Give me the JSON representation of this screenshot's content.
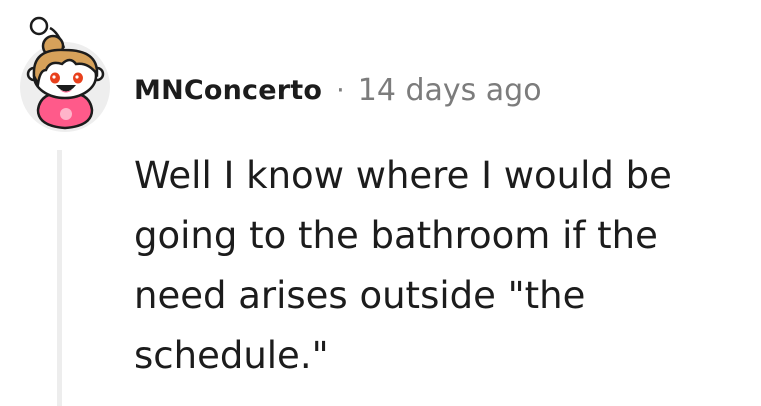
{
  "comment": {
    "author": "MNConcerto",
    "separator": "·",
    "timestamp": "14 days ago",
    "body": "Well I know where I would be going to the bathroom if the need arises outside \"the schedule.\"",
    "avatar": {
      "icon": "snoo-avatar-icon",
      "background_color": "#eeeeee",
      "hair_color": "#d6a15a",
      "shirt_color": "#ff5a8a"
    }
  },
  "colors": {
    "text_primary": "#1c1c1c",
    "text_meta": "#7c7c7c",
    "thread_line": "#ededed"
  }
}
